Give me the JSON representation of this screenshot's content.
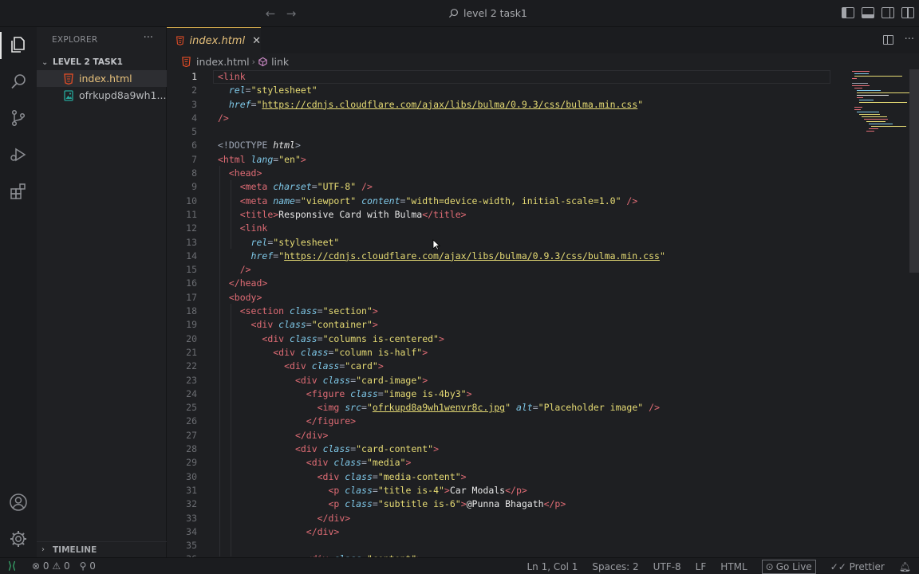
{
  "window": {
    "title": "level 2 task1"
  },
  "explorer": {
    "header": "EXPLORER",
    "folder": "LEVEL 2 TASK1",
    "files": [
      {
        "name": "index.html",
        "icon": "html-file-icon",
        "color": "#e44d26"
      },
      {
        "name": "ofrkupd8a9wh1...",
        "icon": "image-file-icon",
        "color": "#26a69a"
      }
    ],
    "timeline": "TIMELINE"
  },
  "editor": {
    "tab": {
      "label": "index.html",
      "close": "✕"
    },
    "breadcrumb": {
      "file": "index.html",
      "symbol": "link"
    },
    "active_line": "1",
    "lines": [
      [
        [
          "t-tag",
          "<link"
        ]
      ],
      [
        [
          "",
          "  "
        ],
        [
          "t-attr",
          "rel"
        ],
        [
          "t-punc",
          "="
        ],
        [
          "t-str",
          "\"stylesheet\""
        ]
      ],
      [
        [
          "",
          "  "
        ],
        [
          "t-attr",
          "href"
        ],
        [
          "t-punc",
          "="
        ],
        [
          "t-str",
          "\""
        ],
        [
          "t-url",
          "https://cdnjs.cloudflare.com/ajax/libs/bulma/0.9.3/css/bulma.min.css"
        ],
        [
          "t-str",
          "\""
        ]
      ],
      [
        [
          "t-tag",
          "/>"
        ]
      ],
      [],
      [
        [
          "t-doc",
          "<!DOCTYPE "
        ],
        [
          "t-dockw",
          "html"
        ],
        [
          "t-doc",
          ">"
        ]
      ],
      [
        [
          "t-tag",
          "<html "
        ],
        [
          "t-attr",
          "lang"
        ],
        [
          "t-punc",
          "="
        ],
        [
          "t-str",
          "\"en\""
        ],
        [
          "t-tag",
          ">"
        ]
      ],
      [
        [
          "",
          "  "
        ],
        [
          "t-tag",
          "<head>"
        ]
      ],
      [
        [
          "",
          "    "
        ],
        [
          "t-tag",
          "<meta "
        ],
        [
          "t-attr",
          "charset"
        ],
        [
          "t-punc",
          "="
        ],
        [
          "t-str",
          "\"UTF-8\""
        ],
        [
          "t-tag",
          " />"
        ]
      ],
      [
        [
          "",
          "    "
        ],
        [
          "t-tag",
          "<meta "
        ],
        [
          "t-attr",
          "name"
        ],
        [
          "t-punc",
          "="
        ],
        [
          "t-str",
          "\"viewport\""
        ],
        [
          "t-attr",
          " content"
        ],
        [
          "t-punc",
          "="
        ],
        [
          "t-str",
          "\"width=device-width, initial-scale=1.0\""
        ],
        [
          "t-tag",
          " />"
        ]
      ],
      [
        [
          "",
          "    "
        ],
        [
          "t-tag",
          "<title>"
        ],
        [
          "t-text",
          "Responsive Card with Bulma"
        ],
        [
          "t-tag",
          "</title>"
        ]
      ],
      [
        [
          "",
          "    "
        ],
        [
          "t-tag",
          "<link"
        ]
      ],
      [
        [
          "",
          "      "
        ],
        [
          "t-attr",
          "rel"
        ],
        [
          "t-punc",
          "="
        ],
        [
          "t-str",
          "\"stylesheet\""
        ]
      ],
      [
        [
          "",
          "      "
        ],
        [
          "t-attr",
          "href"
        ],
        [
          "t-punc",
          "="
        ],
        [
          "t-str",
          "\""
        ],
        [
          "t-url",
          "https://cdnjs.cloudflare.com/ajax/libs/bulma/0.9.3/css/bulma.min.css"
        ],
        [
          "t-str",
          "\""
        ]
      ],
      [
        [
          "",
          "    "
        ],
        [
          "t-tag",
          "/>"
        ]
      ],
      [
        [
          "",
          "  "
        ],
        [
          "t-tag",
          "</head>"
        ]
      ],
      [
        [
          "",
          "  "
        ],
        [
          "t-tag",
          "<body>"
        ]
      ],
      [
        [
          "",
          "    "
        ],
        [
          "t-tag",
          "<section "
        ],
        [
          "t-attr",
          "class"
        ],
        [
          "t-punc",
          "="
        ],
        [
          "t-str",
          "\"section\""
        ],
        [
          "t-tag",
          ">"
        ]
      ],
      [
        [
          "",
          "      "
        ],
        [
          "t-tag",
          "<div "
        ],
        [
          "t-attr",
          "class"
        ],
        [
          "t-punc",
          "="
        ],
        [
          "t-str",
          "\"container\""
        ],
        [
          "t-tag",
          ">"
        ]
      ],
      [
        [
          "",
          "        "
        ],
        [
          "t-tag",
          "<div "
        ],
        [
          "t-attr",
          "class"
        ],
        [
          "t-punc",
          "="
        ],
        [
          "t-str",
          "\"columns is-centered\""
        ],
        [
          "t-tag",
          ">"
        ]
      ],
      [
        [
          "",
          "          "
        ],
        [
          "t-tag",
          "<div "
        ],
        [
          "t-attr",
          "class"
        ],
        [
          "t-punc",
          "="
        ],
        [
          "t-str",
          "\"column is-half\""
        ],
        [
          "t-tag",
          ">"
        ]
      ],
      [
        [
          "",
          "            "
        ],
        [
          "t-tag",
          "<div "
        ],
        [
          "t-attr",
          "class"
        ],
        [
          "t-punc",
          "="
        ],
        [
          "t-str",
          "\"card\""
        ],
        [
          "t-tag",
          ">"
        ]
      ],
      [
        [
          "",
          "              "
        ],
        [
          "t-tag",
          "<div "
        ],
        [
          "t-attr",
          "class"
        ],
        [
          "t-punc",
          "="
        ],
        [
          "t-str",
          "\"card-image\""
        ],
        [
          "t-tag",
          ">"
        ]
      ],
      [
        [
          "",
          "                "
        ],
        [
          "t-tag",
          "<figure "
        ],
        [
          "t-attr",
          "class"
        ],
        [
          "t-punc",
          "="
        ],
        [
          "t-str",
          "\"image is-4by3\""
        ],
        [
          "t-tag",
          ">"
        ]
      ],
      [
        [
          "",
          "                  "
        ],
        [
          "t-tag",
          "<img "
        ],
        [
          "t-attr",
          "src"
        ],
        [
          "t-punc",
          "="
        ],
        [
          "t-str",
          "\""
        ],
        [
          "t-url",
          "ofrkupd8a9wh1wenvr8c.jpg"
        ],
        [
          "t-str",
          "\""
        ],
        [
          "t-attr",
          " alt"
        ],
        [
          "t-punc",
          "="
        ],
        [
          "t-str",
          "\"Placeholder image\""
        ],
        [
          "t-tag",
          " />"
        ]
      ],
      [
        [
          "",
          "                "
        ],
        [
          "t-tag",
          "</figure>"
        ]
      ],
      [
        [
          "",
          "              "
        ],
        [
          "t-tag",
          "</div>"
        ]
      ],
      [
        [
          "",
          "              "
        ],
        [
          "t-tag",
          "<div "
        ],
        [
          "t-attr",
          "class"
        ],
        [
          "t-punc",
          "="
        ],
        [
          "t-str",
          "\"card-content\""
        ],
        [
          "t-tag",
          ">"
        ]
      ],
      [
        [
          "",
          "                "
        ],
        [
          "t-tag",
          "<div "
        ],
        [
          "t-attr",
          "class"
        ],
        [
          "t-punc",
          "="
        ],
        [
          "t-str",
          "\"media\""
        ],
        [
          "t-tag",
          ">"
        ]
      ],
      [
        [
          "",
          "                  "
        ],
        [
          "t-tag",
          "<div "
        ],
        [
          "t-attr",
          "class"
        ],
        [
          "t-punc",
          "="
        ],
        [
          "t-str",
          "\"media-content\""
        ],
        [
          "t-tag",
          ">"
        ]
      ],
      [
        [
          "",
          "                    "
        ],
        [
          "t-tag",
          "<p "
        ],
        [
          "t-attr",
          "class"
        ],
        [
          "t-punc",
          "="
        ],
        [
          "t-str",
          "\"title is-4\""
        ],
        [
          "t-tag",
          ">"
        ],
        [
          "t-text",
          "Car Modals"
        ],
        [
          "t-tag",
          "</p>"
        ]
      ],
      [
        [
          "",
          "                    "
        ],
        [
          "t-tag",
          "<p "
        ],
        [
          "t-attr",
          "class"
        ],
        [
          "t-punc",
          "="
        ],
        [
          "t-str",
          "\"subtitle is-6\""
        ],
        [
          "t-tag",
          ">"
        ],
        [
          "t-text",
          "@Punna Bhagath"
        ],
        [
          "t-tag",
          "</p>"
        ]
      ],
      [
        [
          "",
          "                  "
        ],
        [
          "t-tag",
          "</div>"
        ]
      ],
      [
        [
          "",
          "                "
        ],
        [
          "t-tag",
          "</div>"
        ]
      ],
      [],
      [
        [
          "",
          "                "
        ],
        [
          "t-tag",
          "<div "
        ],
        [
          "t-attr",
          "class"
        ],
        [
          "t-punc",
          "="
        ],
        [
          "t-str",
          "\"content\""
        ],
        [
          "t-tag",
          ">"
        ]
      ]
    ]
  },
  "statusbar": {
    "errors": "0",
    "warnings": "0",
    "ports": "0",
    "position": "Ln 1, Col 1",
    "spaces": "Spaces: 2",
    "encoding": "UTF-8",
    "eol": "LF",
    "language": "HTML",
    "golive": "Go Live",
    "prettier": "Prettier"
  },
  "colors": {
    "accent_tab_border": "#c9a24a",
    "html_icon": "#e44d26",
    "image_icon": "#26a69a",
    "remote": "#3ec27a"
  }
}
